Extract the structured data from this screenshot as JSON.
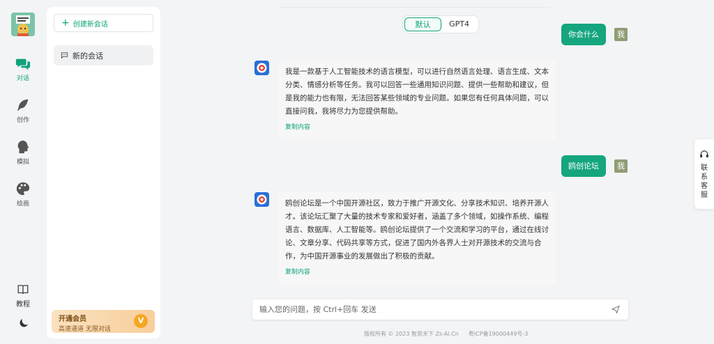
{
  "rail": {
    "items": [
      {
        "label": "对话",
        "icon": "chat-icon"
      },
      {
        "label": "创作",
        "icon": "feather-icon"
      },
      {
        "label": "模拟",
        "icon": "head-icon"
      },
      {
        "label": "绘画",
        "icon": "palette-icon"
      }
    ],
    "tutorial": {
      "label": "教程",
      "icon": "book-icon"
    },
    "theme_icon": "moon-icon"
  },
  "sidebar": {
    "new_chat": "创建新会话",
    "sessions": [
      {
        "label": "新的会话",
        "icon": "message-icon"
      }
    ],
    "vip": {
      "title": "开通会员",
      "subtitle": "高速通道 无限对话",
      "badge": "V"
    }
  },
  "modes": {
    "default": "默认",
    "gpt4": "GPT4"
  },
  "messages": [
    {
      "role": "user",
      "text": "你会什么",
      "avatar": "我"
    },
    {
      "role": "bot",
      "text": "我是一款基于人工智能技术的语言模型，可以进行自然语言处理、语言生成、文本分类、情感分析等任务。我可以回答一些通用知识问题、提供一些帮助和建议，但是我的能力也有限，无法回答某些领域的专业问题。如果您有任何具体问题，可以直接问我，我将尽力为您提供帮助。",
      "copy": "复制内容"
    },
    {
      "role": "user",
      "text": "鸥创论坛",
      "avatar": "我"
    },
    {
      "role": "bot",
      "text": "鸥创论坛是一个中国开源社区，致力于推广开源文化、分享技术知识、培养开源人才。该论坛汇聚了大量的技术专家和爱好者，涵盖了多个领域，如操作系统、编程语言、数据库、人工智能等。鸥创论坛提供了一个交流和学习的平台，通过在线讨论、文章分享、代码共享等方式，促进了国内外各界人士对开源技术的交流与合作，为中国开源事业的发展做出了积极的贡献。",
      "copy": "复制内容"
    }
  ],
  "input": {
    "placeholder": "输入您的问题，按 Ctrl+回车 发送"
  },
  "footer": {
    "copyright": "版权所有 © 2023 智思天下 Zs-Ai.Cn",
    "icp": "粤ICP备19000449号-3"
  },
  "contact": {
    "label": "联系客服"
  },
  "colors": {
    "accent": "#15a67f",
    "vip": "#f7cf9c"
  }
}
